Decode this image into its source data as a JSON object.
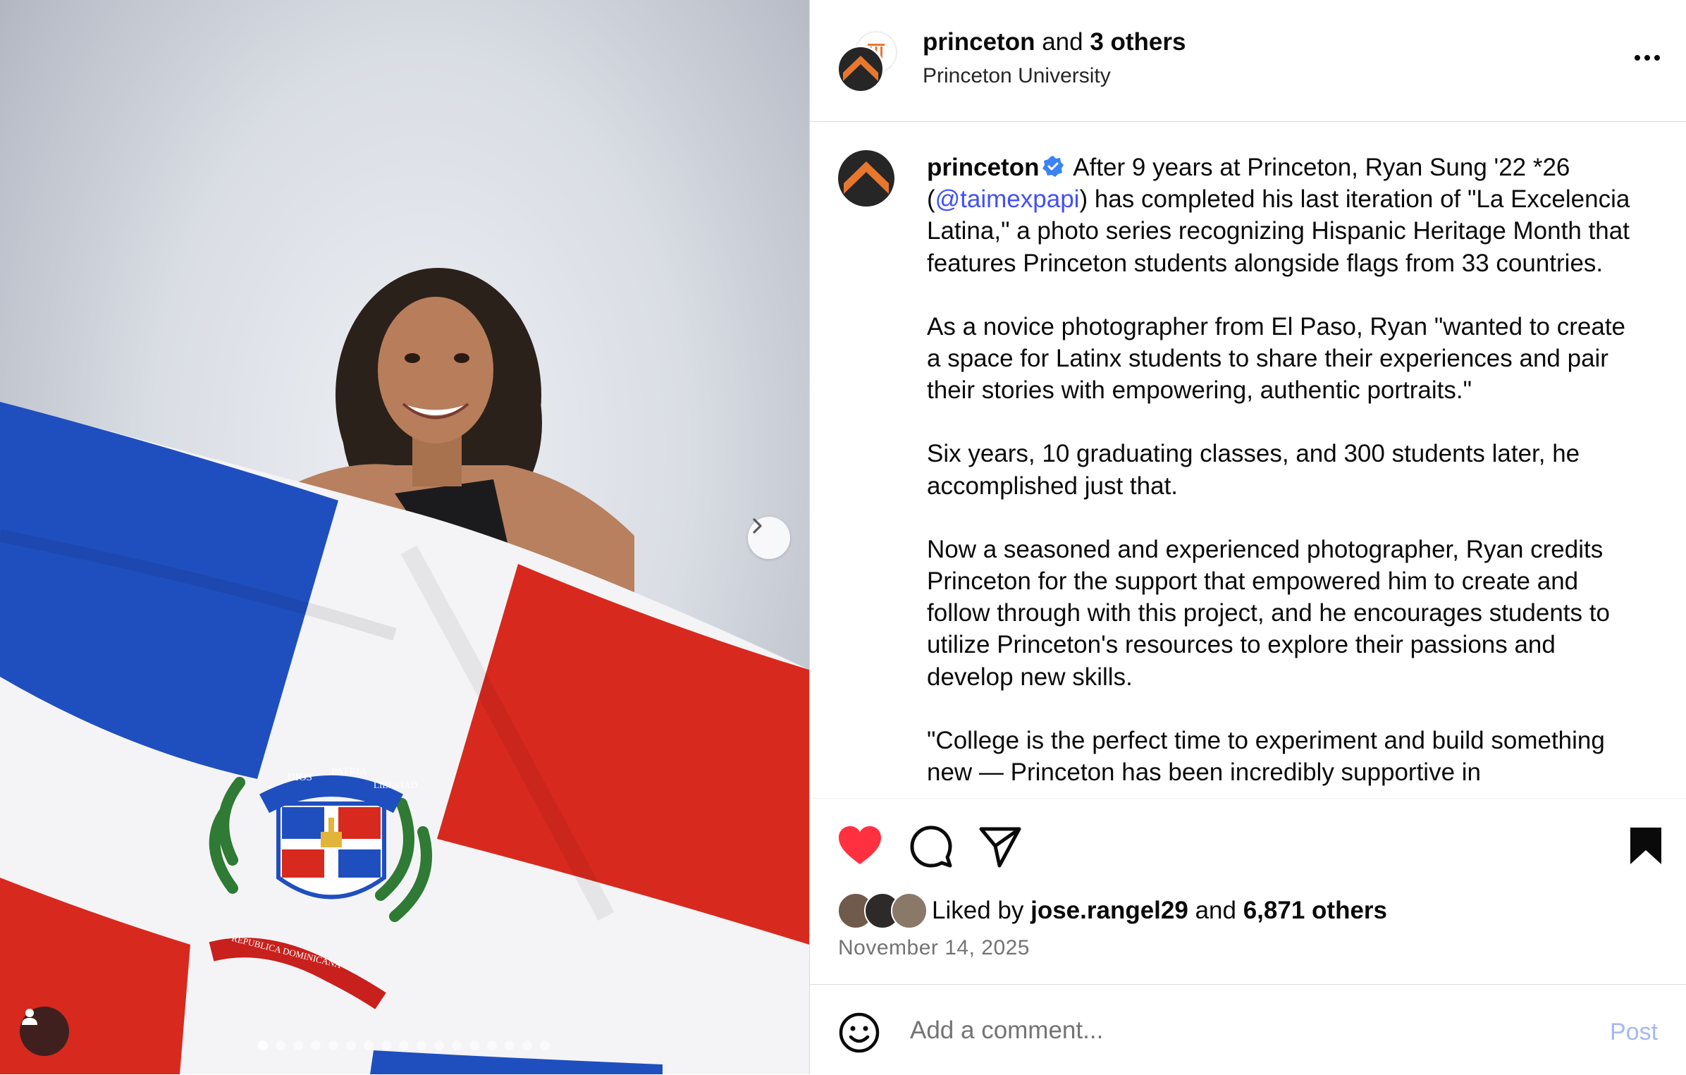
{
  "post": {
    "author": "princeton",
    "collab_suffix": "and",
    "collab_others": "3 others",
    "subtitle": "Princeton University"
  },
  "caption": {
    "username": "princeton",
    "p1_a": "After 9 years at Princeton, Ryan Sung '22 *26 (",
    "mention": "@taimexpapi",
    "p1_b": ") has completed his last iteration of \"La Excelencia Latina,\" a photo series recognizing Hispanic Heritage Month that features Princeton students alongside flags from 33 countries.",
    "p2": "As a novice photographer from El Paso, Ryan \"wanted to create a space for Latinx students to share their experiences and pair their stories with empowering, authentic portraits.\"",
    "p3": "Six years, 10 graduating classes, and 300 students later, he accomplished just that.",
    "p4": "Now a seasoned and experienced photographer, Ryan credits Princeton for the support that empowered him to create and follow through with this project, and he encourages students to utilize Princeton's resources to explore their passions and develop new skills.",
    "p5": "\"College is the perfect time to experiment and build something new — Princeton has been incredibly supportive in"
  },
  "likes": {
    "prefix": "Liked by",
    "user": "jose.rangel29",
    "middle": "and",
    "others": "6,871 others"
  },
  "date": "November 14, 2025",
  "comment": {
    "placeholder": "Add a comment...",
    "post_label": "Post"
  },
  "carousel": {
    "slide_count": 17,
    "current_slide": 1
  },
  "flag_text": {
    "motto_1": "DIOS",
    "motto_2": "PATRIA",
    "motto_3": "LIBERTAD",
    "ribbon": "REPUBLICA DOMINICANA"
  },
  "icons": {
    "like": "heart-filled-icon",
    "comment": "speech-bubble-icon",
    "share": "paper-plane-icon",
    "save": "bookmark-filled-icon",
    "more": "more-horizontal-icon",
    "emoji": "smiley-icon",
    "next": "chevron-right-icon",
    "tag": "person-tag-icon",
    "verified": "verified-badge-icon"
  },
  "colors": {
    "like_red": "#ff3040",
    "link_blue": "#4150f7",
    "post_disabled": "#a4b8f3",
    "princeton_orange": "#e8772e"
  }
}
